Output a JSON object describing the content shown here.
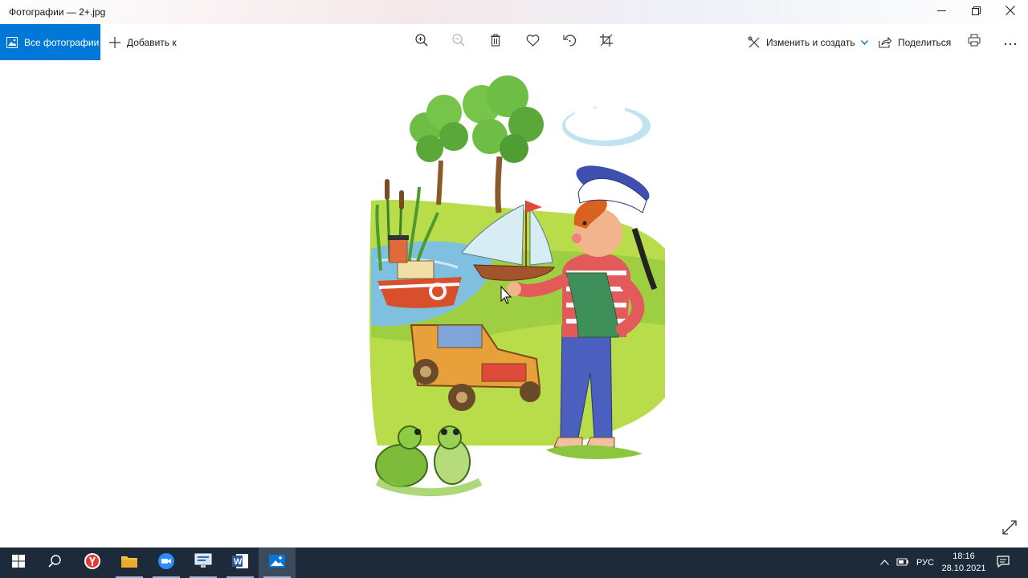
{
  "window": {
    "title": "Фотографии — 2+.jpg",
    "controls": [
      "minimize-icon",
      "restore-icon",
      "close-icon"
    ]
  },
  "toolbar": {
    "all_photos_label": "Все фотографии",
    "add_to_label": "Добавить к",
    "center_buttons": [
      "zoom-in-icon",
      "zoom-out-icon",
      "delete-icon",
      "favorite-icon",
      "rotate-icon",
      "crop-icon"
    ],
    "edit_create_label": "Изменить и создать",
    "share_label": "Поделиться",
    "right_buttons": [
      "print-icon",
      "more-icon"
    ],
    "accent_color": "#0078d7"
  },
  "image": {
    "description_icon": "illustration",
    "scenes": [
      "trees",
      "cloud",
      "pond",
      "steamboat",
      "sailboat",
      "boy-sailor",
      "toy-jeep",
      "frogs"
    ]
  },
  "taskbar": {
    "apps": [
      "start-icon",
      "search-icon",
      "yandex-browser-icon",
      "file-explorer-icon",
      "zoom-icon",
      "monitor-app-icon",
      "word-icon",
      "photos-icon"
    ],
    "language": "РУС",
    "time": "18:16",
    "date": "28.10.2021",
    "background": "#1c2a3a"
  }
}
